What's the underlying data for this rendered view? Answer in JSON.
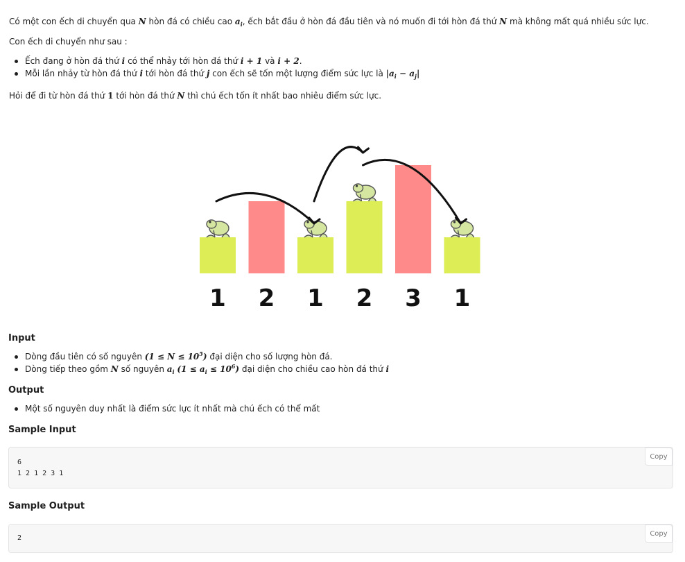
{
  "problem": {
    "intro_a": "Có một con ếch di chuyển qua",
    "intro_b": "hòn đá có chiều cao",
    "intro_c": ", ếch bắt đầu ở hòn đá đầu tiên và nó muốn đi tới hòn đá thứ",
    "intro_d": "mà không mất quá nhiều sức lực.",
    "moves_title": "Con ếch di chuyển như sau :",
    "rule1_a": "Ếch đang ở hòn đá thứ",
    "rule1_b": "có thể nhảy tới hòn đá thứ",
    "rule1_c": "và",
    "rule1_d": ".",
    "rule2_a": "Mỗi lần nhảy từ hòn đá thứ",
    "rule2_b": "tới hòn đá thứ",
    "rule2_c": "con ếch sẽ tốn một lượng điểm sức lực là",
    "question_a": "Hỏi để đi từ hòn đá thứ",
    "question_b": "tới hòn đá thứ",
    "question_c": "thì chú ếch tốn ít nhất bao nhiêu điểm sức lực."
  },
  "math": {
    "N": "N",
    "a": "a",
    "i": "i",
    "j": "j",
    "one": "1",
    "i_plus_1": "i + 1",
    "i_plus_2": "i + 2",
    "bar_l": "|",
    "minus": " − ",
    "bar_r": "|",
    "n_range_open": "(1 ≤ ",
    "n_range_close": " ≤ 10",
    "n_exp": "5",
    "close": ")",
    "a_range_open": "(1 ≤ ",
    "a_range_close": " ≤ 10",
    "a_exp": "6"
  },
  "illustration": {
    "stones": [
      {
        "label": "1",
        "height": 1,
        "color": "#dced55",
        "frog": true
      },
      {
        "label": "2",
        "height": 2,
        "color": "#ff8a8a",
        "frog": false
      },
      {
        "label": "1",
        "height": 1,
        "color": "#dced55",
        "frog": true
      },
      {
        "label": "2",
        "height": 2,
        "color": "#dced55",
        "frog": true
      },
      {
        "label": "3",
        "height": 3,
        "color": "#ff8a8a",
        "frog": false
      },
      {
        "label": "1",
        "height": 1,
        "color": "#dced55",
        "frog": true
      }
    ],
    "jumps": [
      [
        0,
        2
      ],
      [
        2,
        3
      ],
      [
        3,
        5
      ]
    ],
    "frog_color": "#d4e6a0",
    "arrow_color": "#111111"
  },
  "input": {
    "title": "Input",
    "line1_a": "Dòng đầu tiên có số nguyên",
    "line1_b": "đại diện cho số lượng hòn đá.",
    "line2_a": "Dòng tiếp theo gồm",
    "line2_b": "số nguyên",
    "line2_c": "đại diện cho chiều cao hòn đá thứ"
  },
  "output": {
    "title": "Output",
    "line1": "Một số nguyên duy nhất là điểm sức lực ít nhất mà chú ếch có thể mất"
  },
  "sample_input": {
    "title": "Sample Input",
    "content": "6\n1 2 1 2 3 1",
    "copy_label": "Copy"
  },
  "sample_output": {
    "title": "Sample Output",
    "content": "2",
    "copy_label": "Copy"
  }
}
